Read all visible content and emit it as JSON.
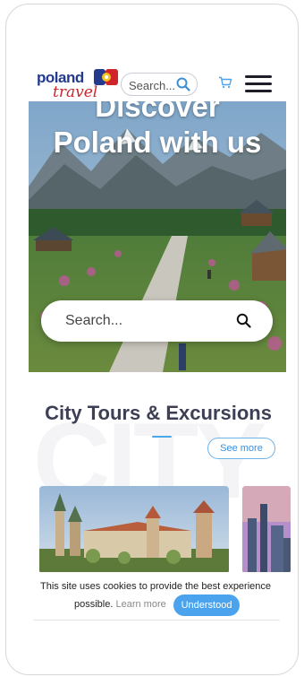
{
  "header": {
    "logo_line1": "poland",
    "logo_line2": "travel",
    "search_placeholder": "Search...",
    "icons": [
      "search-icon",
      "cart-icon",
      "hamburger-menu-icon"
    ]
  },
  "hero": {
    "title_line1": "Discover",
    "title_line2": "Poland with us",
    "search_placeholder": "Search..."
  },
  "section": {
    "watermark": "CITY",
    "title": "City Tours & Excursions",
    "see_more": "See more"
  },
  "cookie": {
    "text_part1": "This site uses cookies to provide the best experience",
    "text_part2": "possible.",
    "learn_more": "Learn more",
    "accept": "Understood"
  },
  "colors": {
    "accent": "#4aa3ec",
    "title": "#3d3f55",
    "logo_blue": "#243a8f",
    "logo_red": "#d1232a"
  }
}
